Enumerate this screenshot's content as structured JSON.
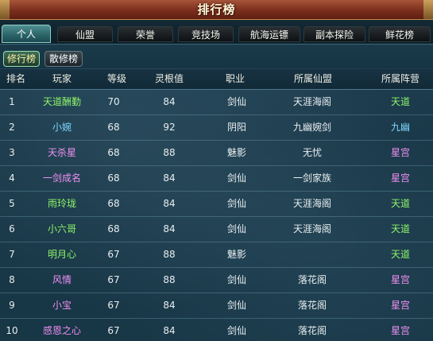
{
  "window": {
    "title": "排行榜"
  },
  "tabs": [
    {
      "label": "个人",
      "active": true
    },
    {
      "label": "仙盟",
      "active": false
    },
    {
      "label": "荣誉",
      "active": false
    },
    {
      "label": "竞技场",
      "active": false
    },
    {
      "label": "航海运镖",
      "active": false
    },
    {
      "label": "副本探险",
      "active": false
    },
    {
      "label": "鲜花榜",
      "active": false
    }
  ],
  "subtabs": [
    {
      "label": "修行榜",
      "active": true
    },
    {
      "label": "散修榜",
      "active": false
    }
  ],
  "table": {
    "columns": [
      "排名",
      "玩家",
      "等级",
      "灵根值",
      "职业",
      "所属仙盟",
      "所属阵营"
    ],
    "rows": [
      {
        "rank": "1",
        "player": "天道酬勤",
        "level": "70",
        "root": "84",
        "job": "剑仙",
        "guild": "天涯海阁",
        "faction": "天道",
        "color": "green"
      },
      {
        "rank": "2",
        "player": "小婉",
        "level": "68",
        "root": "92",
        "job": "阴阳",
        "guild": "九幽婉剑",
        "faction": "九幽",
        "color": "cyan"
      },
      {
        "rank": "3",
        "player": "天杀星",
        "level": "68",
        "root": "88",
        "job": "魅影",
        "guild": "无忧",
        "faction": "星宫",
        "color": "pink"
      },
      {
        "rank": "4",
        "player": "一剑成名",
        "level": "68",
        "root": "84",
        "job": "剑仙",
        "guild": "一剑家族",
        "faction": "星宫",
        "color": "pink"
      },
      {
        "rank": "5",
        "player": "雨玲珑",
        "level": "68",
        "root": "84",
        "job": "剑仙",
        "guild": "天涯海阁",
        "faction": "天道",
        "color": "green"
      },
      {
        "rank": "6",
        "player": "小六哥",
        "level": "68",
        "root": "84",
        "job": "剑仙",
        "guild": "天涯海阁",
        "faction": "天道",
        "color": "green"
      },
      {
        "rank": "7",
        "player": "明月心",
        "level": "67",
        "root": "88",
        "job": "魅影",
        "guild": "",
        "faction": "天道",
        "color": "green"
      },
      {
        "rank": "8",
        "player": "风情",
        "level": "67",
        "root": "88",
        "job": "剑仙",
        "guild": "落花阁",
        "faction": "星宫",
        "color": "pink"
      },
      {
        "rank": "9",
        "player": "小宝",
        "level": "67",
        "root": "84",
        "job": "剑仙",
        "guild": "落花阁",
        "faction": "星宫",
        "color": "pink"
      },
      {
        "rank": "10",
        "player": "感恩之心",
        "level": "67",
        "root": "84",
        "job": "剑仙",
        "guild": "落花阁",
        "faction": "星宫",
        "color": "pink"
      }
    ]
  },
  "colors": {
    "green": "#8ff56a",
    "cyan": "#7fd8ff",
    "pink": "#f08ff2"
  }
}
